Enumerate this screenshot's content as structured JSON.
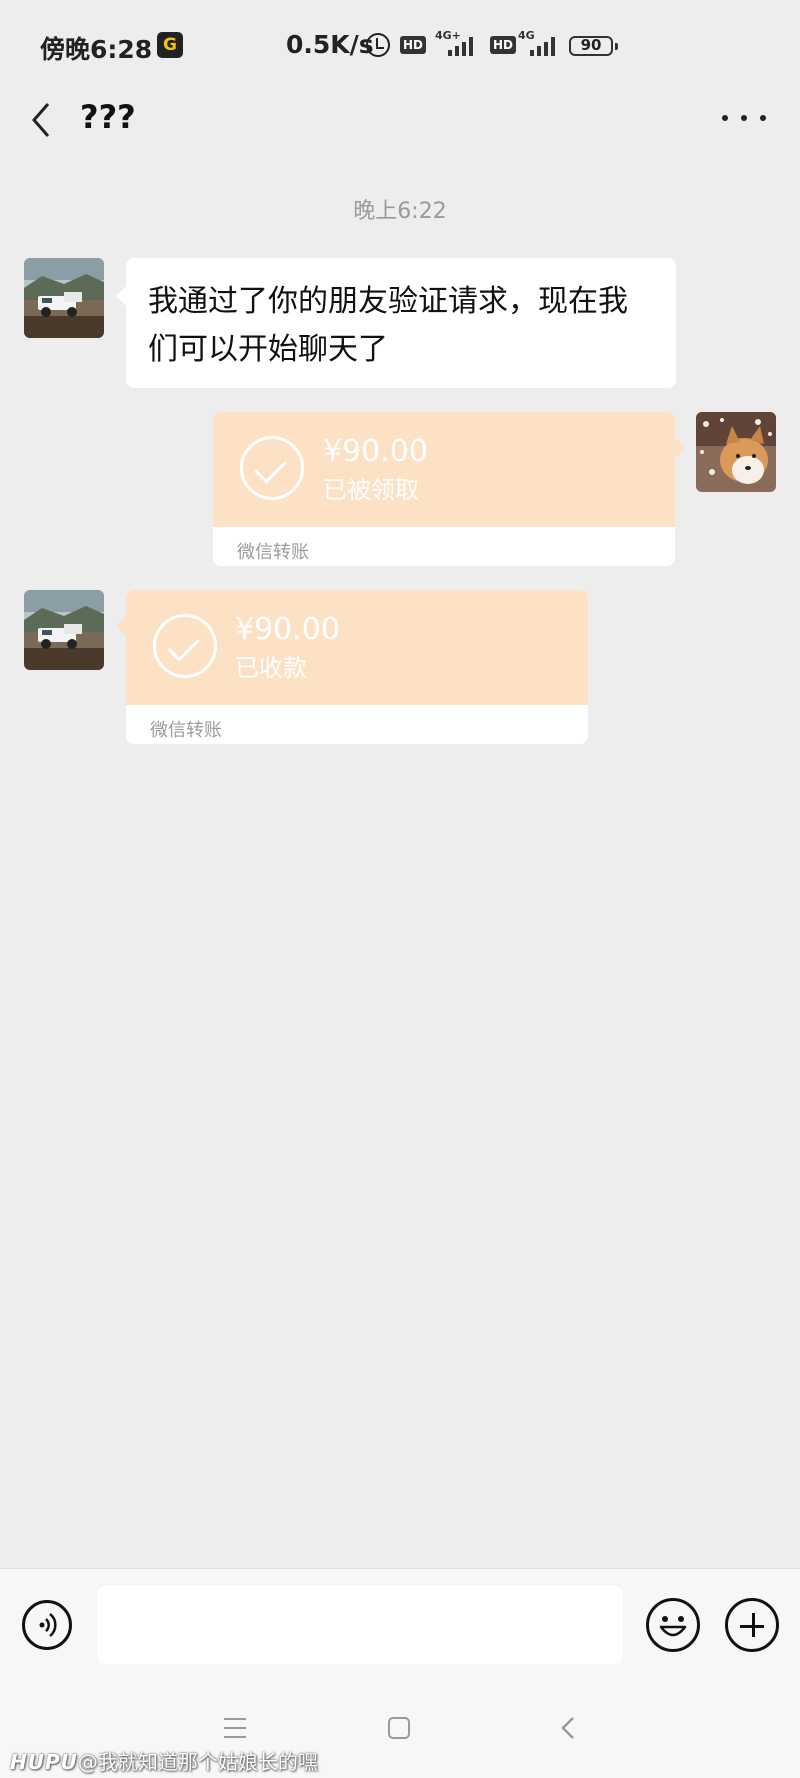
{
  "status_bar": {
    "time": "傍晚6:28",
    "app_badge": "G",
    "net_speed": "0.5K/s",
    "hd1": "HD",
    "net1": "4G+",
    "hd2": "HD",
    "net2": "4G",
    "battery": "90"
  },
  "header": {
    "title": "???"
  },
  "chat": {
    "timestamp": "晚上6:22",
    "messages": [
      {
        "type": "text",
        "from": "other",
        "text": "我通过了你的朋友验证请求，现在我们可以开始聊天了"
      },
      {
        "type": "transfer",
        "from": "me",
        "amount": "¥90.00",
        "status": "已被领取",
        "label": "微信转账"
      },
      {
        "type": "transfer",
        "from": "other",
        "amount": "¥90.00",
        "status": "已收款",
        "label": "微信转账"
      }
    ]
  },
  "input": {
    "value": "",
    "placeholder": ""
  },
  "watermark": {
    "brand": "HUPU",
    "text": "@我就知道那个姑娘长的嘿"
  },
  "colors": {
    "background": "#ededed",
    "transfer_bg": "#fce1c5",
    "bubble": "#ffffff"
  }
}
